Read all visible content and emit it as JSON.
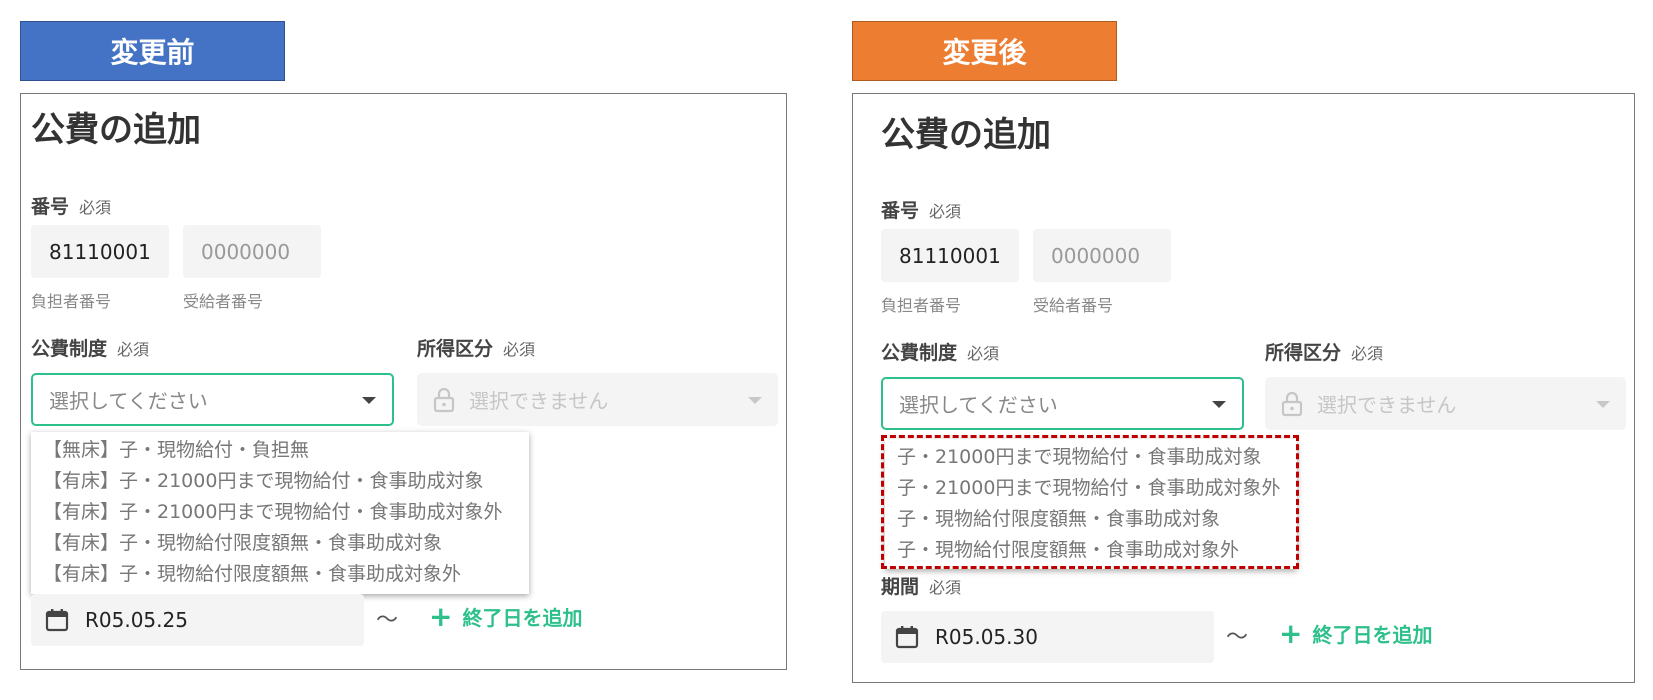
{
  "badges": {
    "before": "変更前",
    "after": "変更後"
  },
  "colors": {
    "before_badge": "#4472c4",
    "after_badge": "#ed7d31",
    "accent": "#2ec08b",
    "highlight": "#c00000"
  },
  "form": {
    "title": "公費の追加",
    "number": {
      "label": "番号",
      "required": "必須",
      "payer_value": "81110001",
      "payer_caption": "負担者番号",
      "recipient_placeholder": "0000000",
      "recipient_caption": "受給者番号"
    },
    "system": {
      "label": "公費制度",
      "required": "必須",
      "placeholder": "選択してください"
    },
    "income": {
      "label": "所得区分",
      "required": "必須",
      "placeholder": "選択できません",
      "icon": "lock-icon"
    },
    "period": {
      "label": "期間",
      "required": "必須",
      "add_end_label": "終了日を追加",
      "tilde": "〜",
      "icon": "calendar-icon"
    }
  },
  "before": {
    "date_value": "R05.05.25",
    "options": [
      "【無床】子・現物給付・負担無",
      "【有床】子・21000円まで現物給付・食事助成対象",
      "【有床】子・21000円まで現物給付・食事助成対象外",
      "【有床】子・現物給付限度額無・食事助成対象",
      "【有床】子・現物給付限度額無・食事助成対象外"
    ]
  },
  "after": {
    "date_value": "R05.05.30",
    "options": [
      "子・21000円まで現物給付・食事助成対象",
      "子・21000円まで現物給付・食事助成対象外",
      "子・現物給付限度額無・食事助成対象",
      "子・現物給付限度額無・食事助成対象外"
    ]
  }
}
